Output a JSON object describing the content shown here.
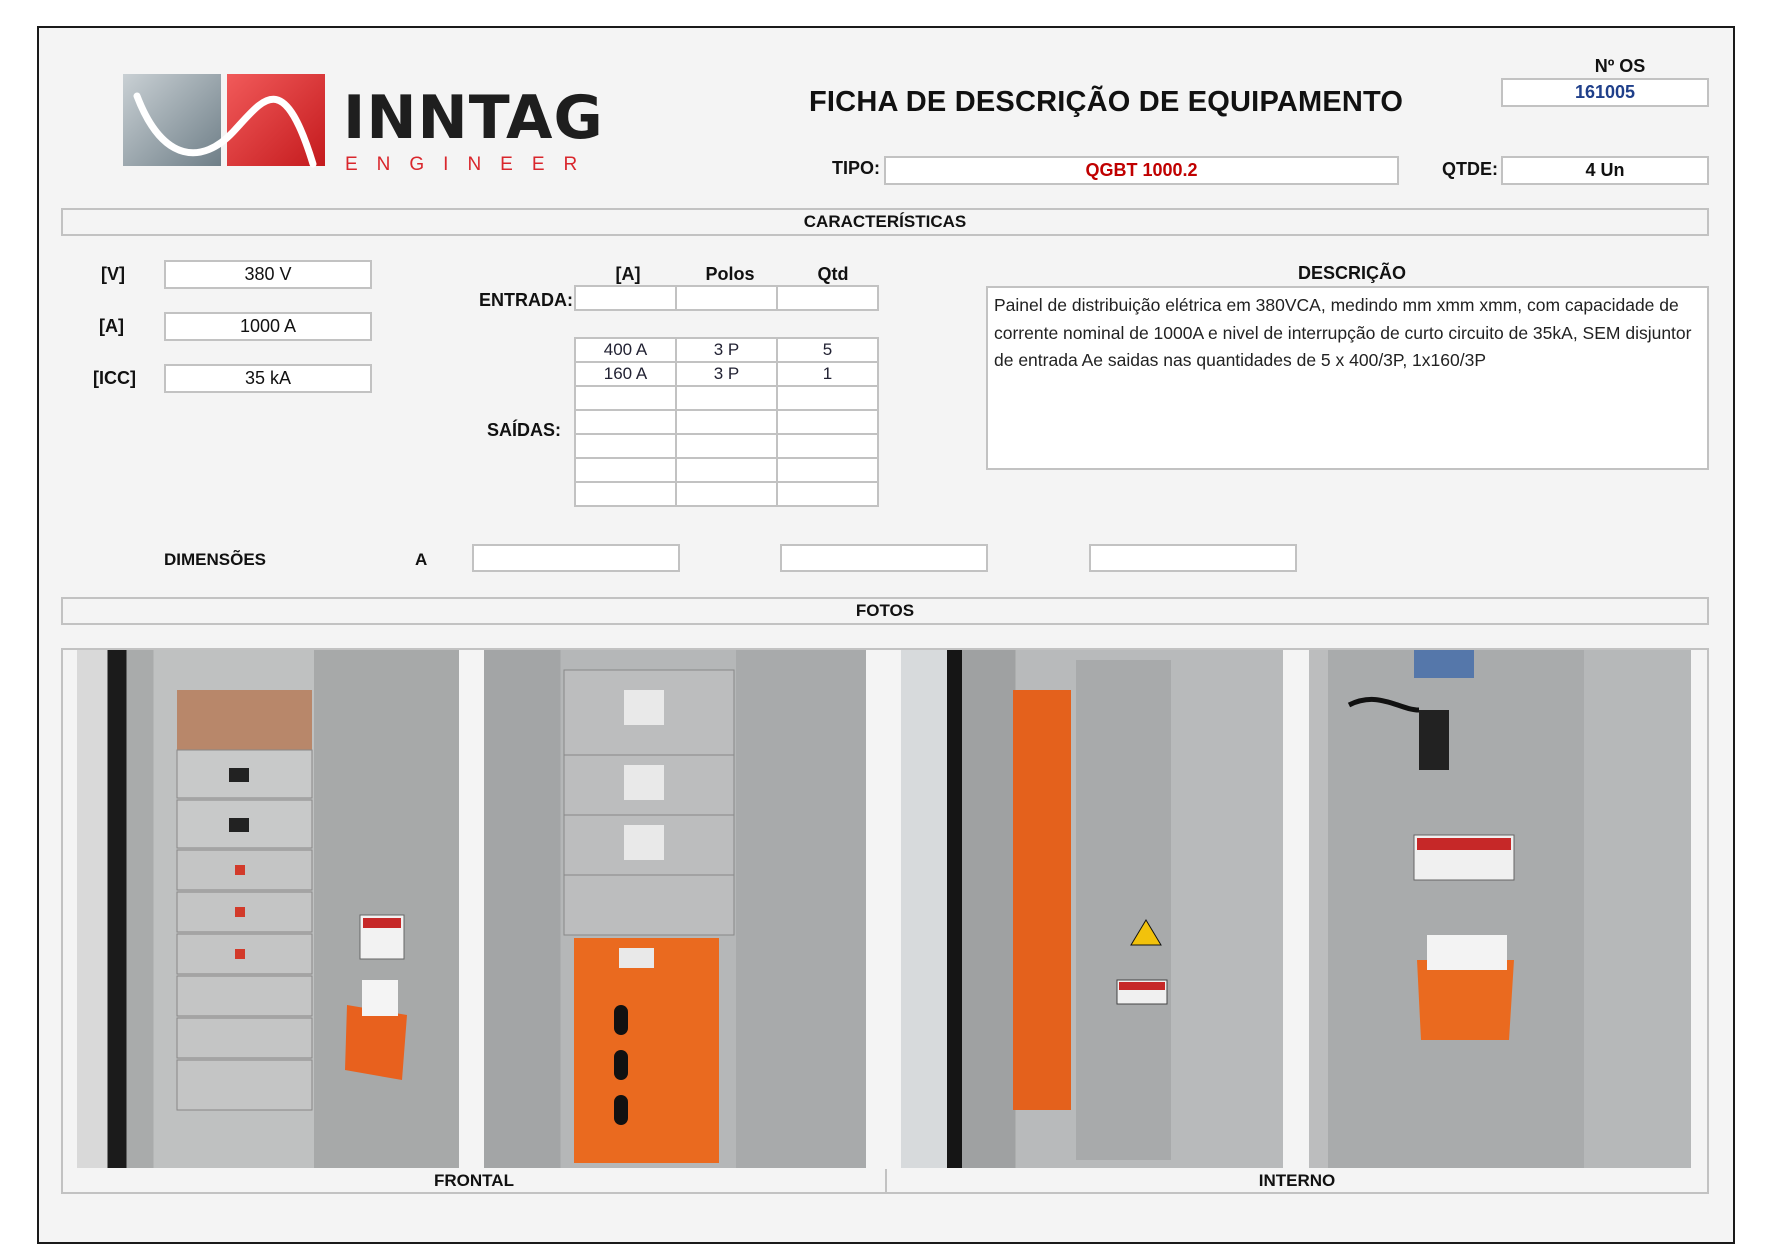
{
  "logo": {
    "brand": "INNTAG",
    "subtitle": "ENGINEER",
    "brand_color": "#1e1e1e",
    "subtitle_color": "#d9262c"
  },
  "header": {
    "title": "FICHA DE DESCRIÇÃO DE EQUIPAMENTO",
    "os_label": "Nº OS",
    "os_value": "161005",
    "tipo_label": "TIPO:",
    "tipo_value": "QGBT 1000.2",
    "qtde_label": "QTDE:",
    "qtde_value": "4 Un"
  },
  "colors": {
    "os_value": "#1f3f8a",
    "tipo_value": "#c00000"
  },
  "caracteristicas": {
    "section_title": "CARACTERÍSTICAS",
    "specs": [
      {
        "label": "[V]",
        "value": "380 V"
      },
      {
        "label": "[A]",
        "value": "1000 A"
      },
      {
        "label": "[ICC]",
        "value": "35 kA"
      }
    ],
    "columns": [
      "[A]",
      "Polos",
      "Qtd"
    ],
    "entrada_label": "ENTRADA:",
    "entrada": [
      "",
      "",
      ""
    ],
    "saidas_label": "SAÍDAS:",
    "saidas": [
      [
        "400 A",
        "3 P",
        "5"
      ],
      [
        "160 A",
        "3 P",
        "1"
      ],
      [
        "",
        "",
        ""
      ],
      [
        "",
        "",
        ""
      ],
      [
        "",
        "",
        ""
      ],
      [
        "",
        "",
        ""
      ],
      [
        "",
        "",
        ""
      ]
    ],
    "descricao_label": "DESCRIÇÃO",
    "descricao": "Painel de distribuição elétrica em 380VCA, medindo mm xmm xmm, com capacidade de corrente nominal de 1000A e nivel de interrupção de curto circuito de 35kA, SEM disjuntor de entrada Ae saidas nas quantidades de 5 x 400/3P, 1x160/3P",
    "dimensoes_label": "DIMENSÕES",
    "dimensoes_a_label": "A",
    "dimensoes": [
      "",
      "",
      ""
    ]
  },
  "fotos": {
    "section_title": "FOTOS",
    "photos": [
      {
        "alt": "Painel frontal aberto com disjuntores"
      },
      {
        "alt": "Painel frontal com placa laranja"
      },
      {
        "alt": "Interno com barramento laranja"
      },
      {
        "alt": "Interno porta com porta-documentos"
      }
    ],
    "label_frontal": "FRONTAL",
    "label_interno": "INTERNO"
  }
}
